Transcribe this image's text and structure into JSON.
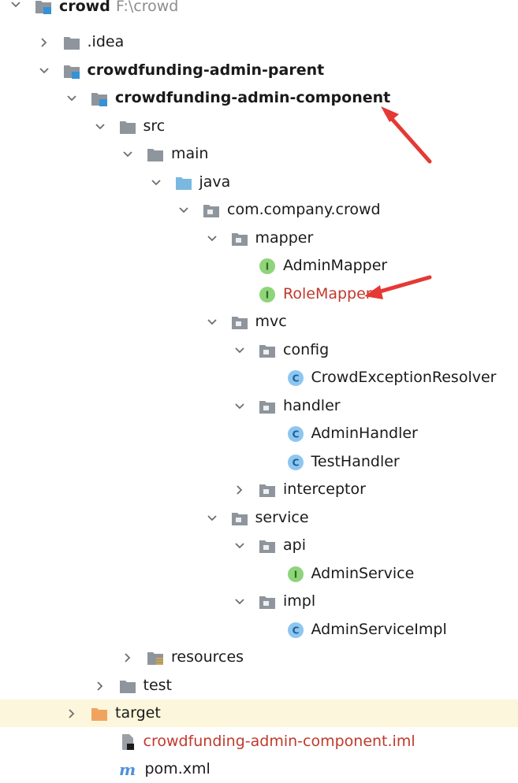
{
  "tree": [
    {
      "key": "crowd",
      "label": "crowd",
      "suffix": "F:\\crowd",
      "depth": 0,
      "expanded": true,
      "icon": "module-folder",
      "bold": true,
      "labelColor": "#1a1a1a"
    },
    {
      "key": "idea",
      "label": ".idea",
      "depth": 1,
      "expanded": false,
      "icon": "folder",
      "labelColor": "#1a1a1a"
    },
    {
      "key": "admin-parent",
      "label": "crowdfunding-admin-parent",
      "depth": 1,
      "expanded": true,
      "icon": "module-folder",
      "bold": true,
      "labelColor": "#1a1a1a"
    },
    {
      "key": "admin-component",
      "label": "crowdfunding-admin-component",
      "depth": 2,
      "expanded": true,
      "icon": "module-folder",
      "bold": true,
      "labelColor": "#1a1a1a"
    },
    {
      "key": "src",
      "label": "src",
      "depth": 3,
      "expanded": true,
      "icon": "folder",
      "labelColor": "#1a1a1a"
    },
    {
      "key": "main",
      "label": "main",
      "depth": 4,
      "expanded": true,
      "icon": "folder",
      "labelColor": "#1a1a1a"
    },
    {
      "key": "java",
      "label": "java",
      "depth": 5,
      "expanded": true,
      "icon": "source-folder",
      "labelColor": "#1a1a1a"
    },
    {
      "key": "pkg-crowd",
      "label": "com.company.crowd",
      "depth": 6,
      "expanded": true,
      "icon": "package",
      "labelColor": "#1a1a1a"
    },
    {
      "key": "mapper",
      "label": "mapper",
      "depth": 7,
      "expanded": true,
      "icon": "package",
      "labelColor": "#1a1a1a"
    },
    {
      "key": "admin-mapper",
      "label": "AdminMapper",
      "depth": 8,
      "icon": "interface",
      "labelColor": "#1a1a1a"
    },
    {
      "key": "role-mapper",
      "label": "RoleMapper",
      "depth": 8,
      "icon": "interface",
      "labelColor": "#c0392b"
    },
    {
      "key": "mvc",
      "label": "mvc",
      "depth": 7,
      "expanded": true,
      "icon": "package",
      "labelColor": "#1a1a1a"
    },
    {
      "key": "config",
      "label": "config",
      "depth": 8,
      "expanded": true,
      "icon": "package",
      "labelColor": "#1a1a1a"
    },
    {
      "key": "crowd-exception-resolver",
      "label": "CrowdExceptionResolver",
      "depth": 9,
      "icon": "class",
      "labelColor": "#1a1a1a"
    },
    {
      "key": "handler",
      "label": "handler",
      "depth": 8,
      "expanded": true,
      "icon": "package",
      "labelColor": "#1a1a1a"
    },
    {
      "key": "admin-handler",
      "label": "AdminHandler",
      "depth": 9,
      "icon": "class",
      "labelColor": "#1a1a1a"
    },
    {
      "key": "test-handler",
      "label": "TestHandler",
      "depth": 9,
      "icon": "class",
      "labelColor": "#1a1a1a"
    },
    {
      "key": "interceptor",
      "label": "interceptor",
      "depth": 8,
      "expanded": false,
      "icon": "package",
      "labelColor": "#1a1a1a"
    },
    {
      "key": "service",
      "label": "service",
      "depth": 7,
      "expanded": true,
      "icon": "package",
      "labelColor": "#1a1a1a"
    },
    {
      "key": "api",
      "label": "api",
      "depth": 8,
      "expanded": true,
      "icon": "package",
      "labelColor": "#1a1a1a"
    },
    {
      "key": "admin-service",
      "label": "AdminService",
      "depth": 9,
      "icon": "interface",
      "labelColor": "#1a1a1a"
    },
    {
      "key": "impl",
      "label": "impl",
      "depth": 8,
      "expanded": true,
      "icon": "package",
      "labelColor": "#1a1a1a"
    },
    {
      "key": "admin-service-impl",
      "label": "AdminServiceImpl",
      "depth": 9,
      "icon": "class",
      "labelColor": "#1a1a1a"
    },
    {
      "key": "resources",
      "label": "resources",
      "depth": 4,
      "expanded": false,
      "icon": "resources-folder",
      "labelColor": "#1a1a1a"
    },
    {
      "key": "test",
      "label": "test",
      "depth": 3,
      "expanded": false,
      "icon": "folder",
      "labelColor": "#1a1a1a"
    },
    {
      "key": "target",
      "label": "target",
      "depth": 2,
      "expanded": false,
      "icon": "excluded-folder",
      "labelColor": "#1a1a1a",
      "highlighted": true
    },
    {
      "key": "iml",
      "label": "crowdfunding-admin-component.iml",
      "depth": 3,
      "icon": "iml-file",
      "labelColor": "#c0392b"
    },
    {
      "key": "pom",
      "label": "pom.xml",
      "depth": 3,
      "icon": "maven-file",
      "labelColor": "#1a1a1a"
    }
  ],
  "icon_badges": {
    "interface": "I",
    "class": "C",
    "maven": "m"
  },
  "colors": {
    "folder": "#8e959c",
    "source_folder": "#79b8e0",
    "module_badge": "#3592d6",
    "interface": "#4caf50",
    "interface_bg": "#8fd47a",
    "class": "#3b8fd4",
    "class_bg": "#8dc7f0",
    "excluded_folder": "#f0a35e",
    "maven": "#4f8fd9",
    "annotation_arrow": "#e53935",
    "highlight_row": "#fbf6dc"
  }
}
